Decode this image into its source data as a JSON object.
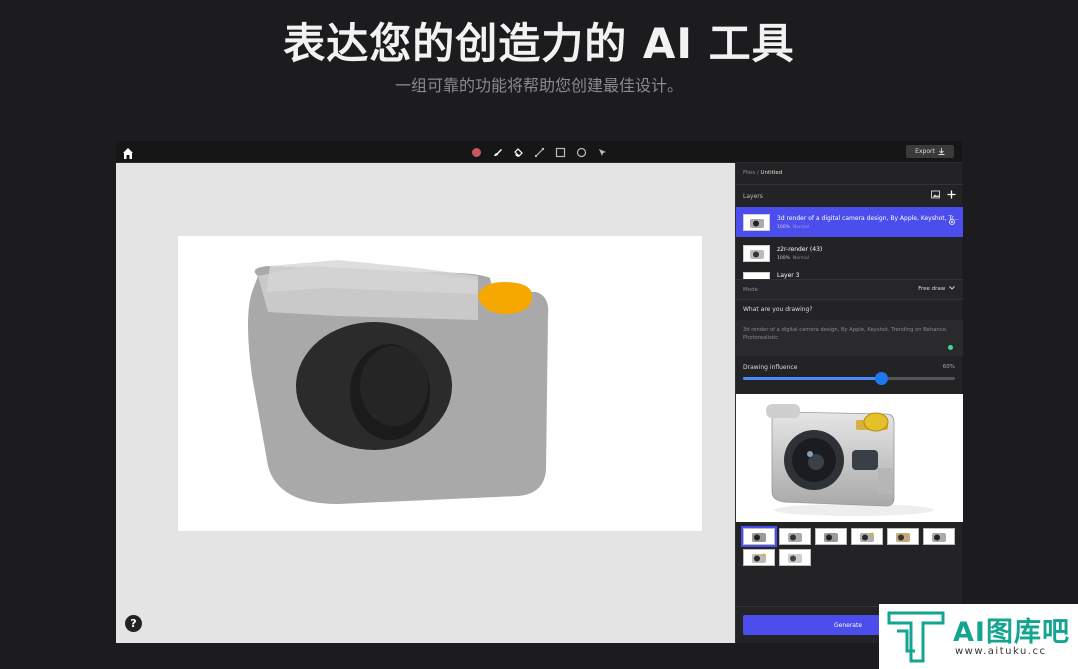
{
  "hero": {
    "title": "表达您的创造力的 AI 工具",
    "subtitle": "一组可靠的功能将帮助您创建最佳设计。"
  },
  "toolbar": {
    "tools": [
      {
        "name": "color-swatch-icon",
        "color": "#c7575f"
      },
      {
        "name": "brush-icon"
      },
      {
        "name": "bucket-icon"
      },
      {
        "name": "line-icon"
      },
      {
        "name": "rectangle-icon"
      },
      {
        "name": "circle-icon"
      },
      {
        "name": "pointer-icon"
      }
    ],
    "export_label": "Export"
  },
  "panel": {
    "breadcrumb": {
      "root": "Files",
      "separator": " / ",
      "current": "Untitled"
    },
    "layers_label": "Layers",
    "layers": [
      {
        "name": "3d render of a digital camera design, By Apple, Keyshot, Tr...",
        "opacity": "100%",
        "mode": "Normal"
      },
      {
        "name": "z2r-render (43)",
        "opacity": "100%",
        "mode": "Normal"
      },
      {
        "name": "Layer 3"
      }
    ],
    "mode_label": "Mode",
    "mode_value": "Free draw",
    "prompt_label": "What are you drawing?",
    "prompt_text": "3d render of a digital camera design, By Apple, Keyshot, Trending on Behance, Photorealistic",
    "influence_label": "Drawing influence",
    "influence_value": "60%",
    "influence_fraction": 0.65,
    "generate_label": "Generate"
  },
  "help_label": "?",
  "watermark": {
    "text": "AI图库吧",
    "url": "www.aituku.cc"
  },
  "colors": {
    "accent": "#4b4ded",
    "sketch_orange": "#f7a800",
    "slider": "#1f78f0"
  }
}
